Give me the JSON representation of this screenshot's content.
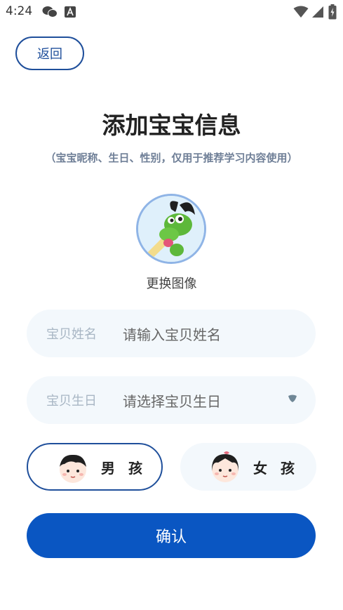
{
  "status_bar": {
    "time": "4:24",
    "icons": [
      "wechat-icon",
      "app-a-icon",
      "wifi-icon",
      "signal-icon",
      "battery-charging-icon"
    ]
  },
  "header": {
    "back_label": "返回"
  },
  "page": {
    "title": "添加宝宝信息",
    "subtitle": "（宝宝昵称、生日、性别，仅用于推荐学习内容使用）"
  },
  "avatar": {
    "change_label": "更换图像"
  },
  "form": {
    "name": {
      "label": "宝贝姓名",
      "placeholder": "请输入宝贝姓名"
    },
    "birthday": {
      "label": "宝贝生日",
      "placeholder": "请选择宝贝生日"
    }
  },
  "gender": {
    "options": [
      {
        "label": "男孩",
        "display": "男 孩",
        "selected": true
      },
      {
        "label": "女孩",
        "display": "女 孩",
        "selected": false
      }
    ]
  },
  "actions": {
    "confirm_label": "确认"
  },
  "colors": {
    "accent": "#0a56c2",
    "outline": "#1f4f9b",
    "field_bg": "#f3f8fc"
  }
}
